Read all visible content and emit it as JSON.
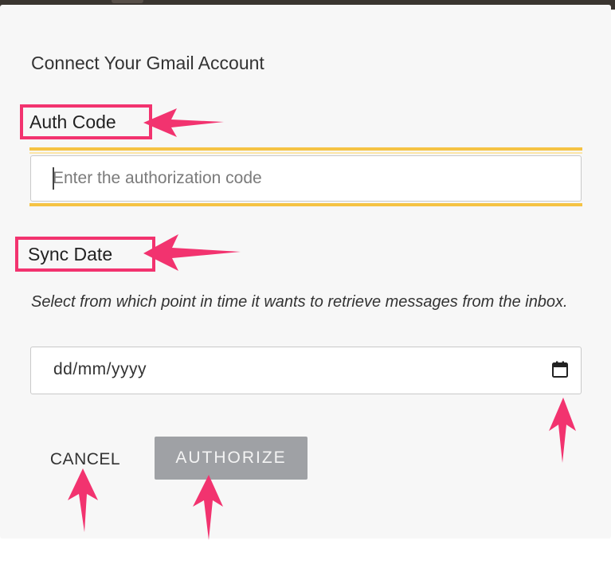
{
  "dialog": {
    "title": "Connect Your Gmail Account"
  },
  "auth_code": {
    "label": "Auth Code",
    "placeholder": "Enter the authorization code",
    "value": ""
  },
  "sync_date": {
    "label": "Sync Date",
    "help_text": "Select from which point in time it wants to retrieve messages from the inbox.",
    "value_display": "dd/mm/yyyy",
    "icon": "calendar-icon"
  },
  "actions": {
    "cancel_label": "CANCEL",
    "authorize_label": "AUTHORIZE"
  },
  "annotations": {
    "color": "#f2336f"
  },
  "colors": {
    "focus_ring": "#f5c344",
    "authorize_bg": "#9fa1a5"
  }
}
